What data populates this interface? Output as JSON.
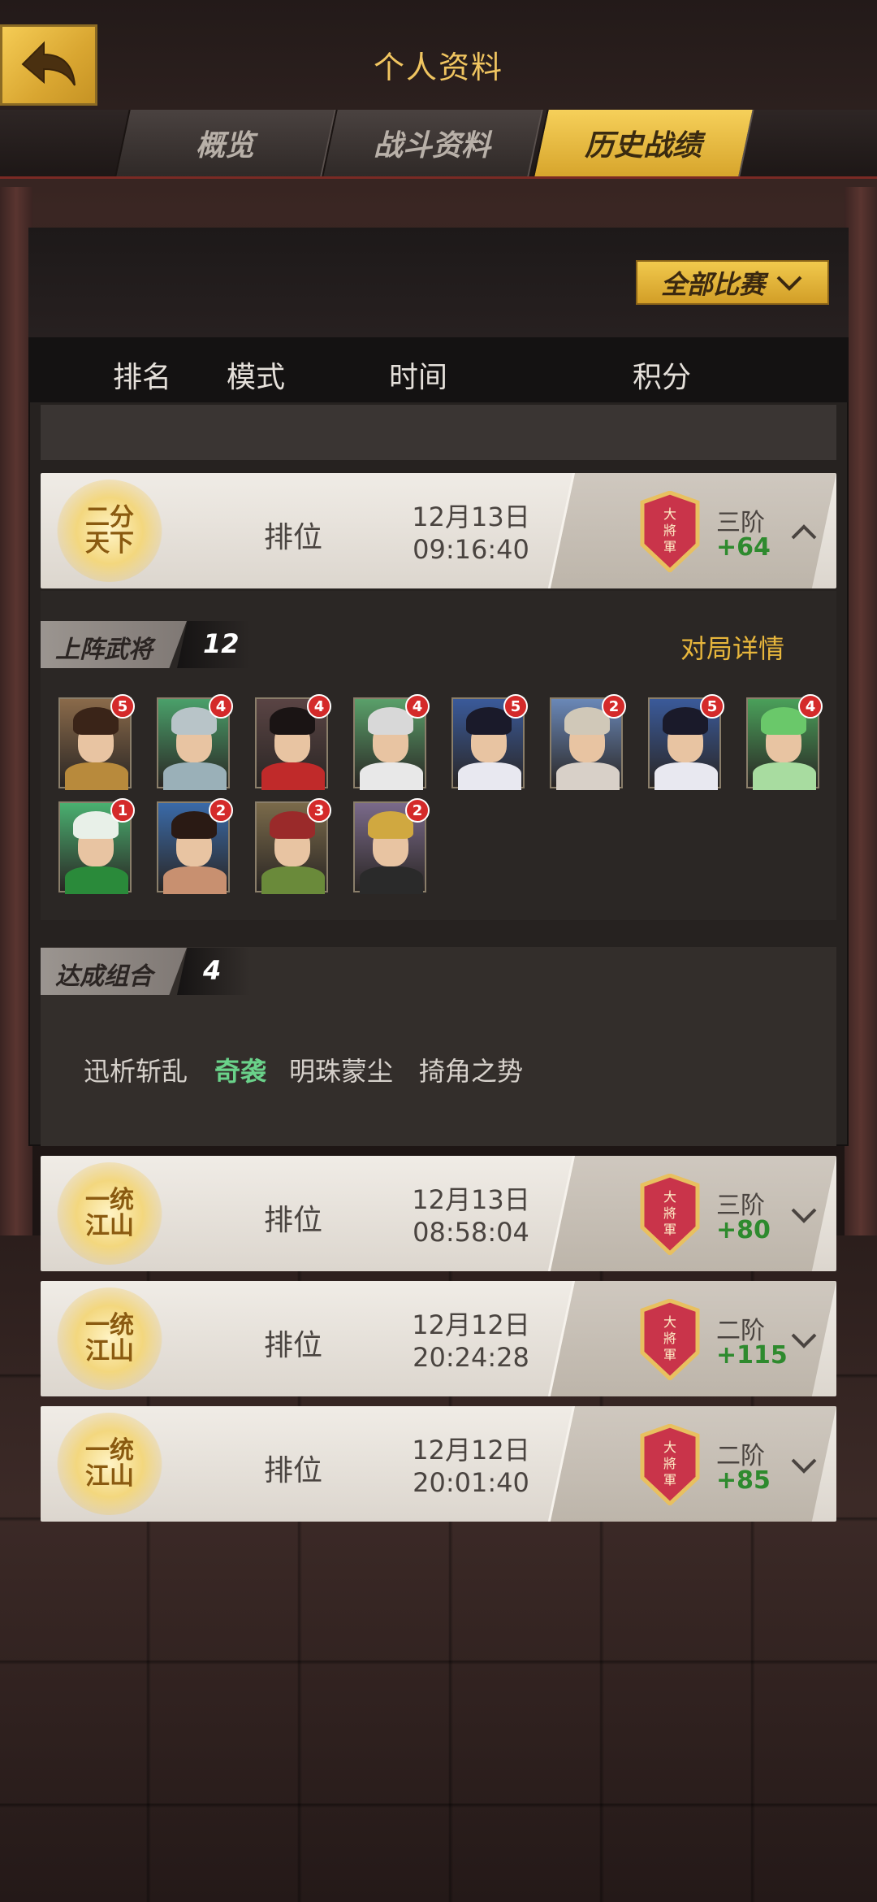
{
  "header": {
    "title": "个人资料",
    "back_icon": "back-arrow-icon"
  },
  "tabs": [
    {
      "label": "概览",
      "active": false
    },
    {
      "label": "战斗资料",
      "active": false
    },
    {
      "label": "历史战绩",
      "active": true
    }
  ],
  "filter": {
    "label": "全部比赛",
    "icon": "chevron-down-icon"
  },
  "columns": [
    "排名",
    "模式",
    "时间",
    "积分"
  ],
  "matches": [
    {
      "emblem": "二分天下",
      "mode": "排位",
      "date": "12月13日",
      "time": "09:16:40",
      "tier": "三阶",
      "score": "+64",
      "expanded": true
    },
    {
      "emblem": "一统江山",
      "mode": "排位",
      "date": "12月13日",
      "time": "08:58:04",
      "tier": "三阶",
      "score": "+80",
      "expanded": false
    },
    {
      "emblem": "一统江山",
      "mode": "排位",
      "date": "12月12日",
      "time": "20:24:28",
      "tier": "二阶",
      "score": "+115",
      "expanded": false
    },
    {
      "emblem": "一统江山",
      "mode": "排位",
      "date": "12月12日",
      "time": "20:01:40",
      "tier": "二阶",
      "score": "+85",
      "expanded": false
    }
  ],
  "heroes_section": {
    "label": "上阵武将",
    "count": "12",
    "detail_link": "对局详情",
    "heroes": [
      {
        "level": "5",
        "bg": "#8a6a4a",
        "hair": "#3a2418",
        "body": "#b88a3c"
      },
      {
        "level": "4",
        "bg": "#4aa06a",
        "hair": "#b8c4c8",
        "body": "#9ab0b8"
      },
      {
        "level": "4",
        "bg": "#5a4444",
        "hair": "#1a1414",
        "body": "#c02a2a"
      },
      {
        "level": "4",
        "bg": "#5aa06a",
        "hair": "#d8d8d8",
        "body": "#e8e8e8"
      },
      {
        "level": "5",
        "bg": "#3a5a9a",
        "hair": "#1a1a2a",
        "body": "#e8e8f0"
      },
      {
        "level": "2",
        "bg": "#6a88b8",
        "hair": "#d0c8b8",
        "body": "#d8d0c8"
      },
      {
        "level": "5",
        "bg": "#3a5a9a",
        "hair": "#1a1a2a",
        "body": "#e8e8f0"
      },
      {
        "level": "4",
        "bg": "#4aa05a",
        "hair": "#6ac86a",
        "body": "#a8dca0"
      },
      {
        "level": "1",
        "bg": "#4ab070",
        "hair": "#e8f0e8",
        "body": "#2a8a3a"
      },
      {
        "level": "2",
        "bg": "#3a6aa8",
        "hair": "#2a1a14",
        "body": "#c89070"
      },
      {
        "level": "3",
        "bg": "#7a6a4a",
        "hair": "#9a2a2a",
        "body": "#6a8a3a"
      },
      {
        "level": "2",
        "bg": "#7a6a8a",
        "hair": "#d0a840",
        "body": "#2a2a2a"
      }
    ]
  },
  "combos_section": {
    "label": "达成组合",
    "count": "4",
    "combos": [
      {
        "text": "迅析斩乱",
        "highlight": false
      },
      {
        "text": "奇袭",
        "highlight": true
      },
      {
        "text": "明珠蒙尘",
        "highlight": false
      },
      {
        "text": "掎角之势",
        "highlight": false
      }
    ]
  },
  "rank_badge_text": "大將軍",
  "colors": {
    "accent_gold": "#f0c560",
    "score_green": "#2e8a2e",
    "combo_highlight": "#6ad28a",
    "link_gold": "#e7b63c"
  }
}
